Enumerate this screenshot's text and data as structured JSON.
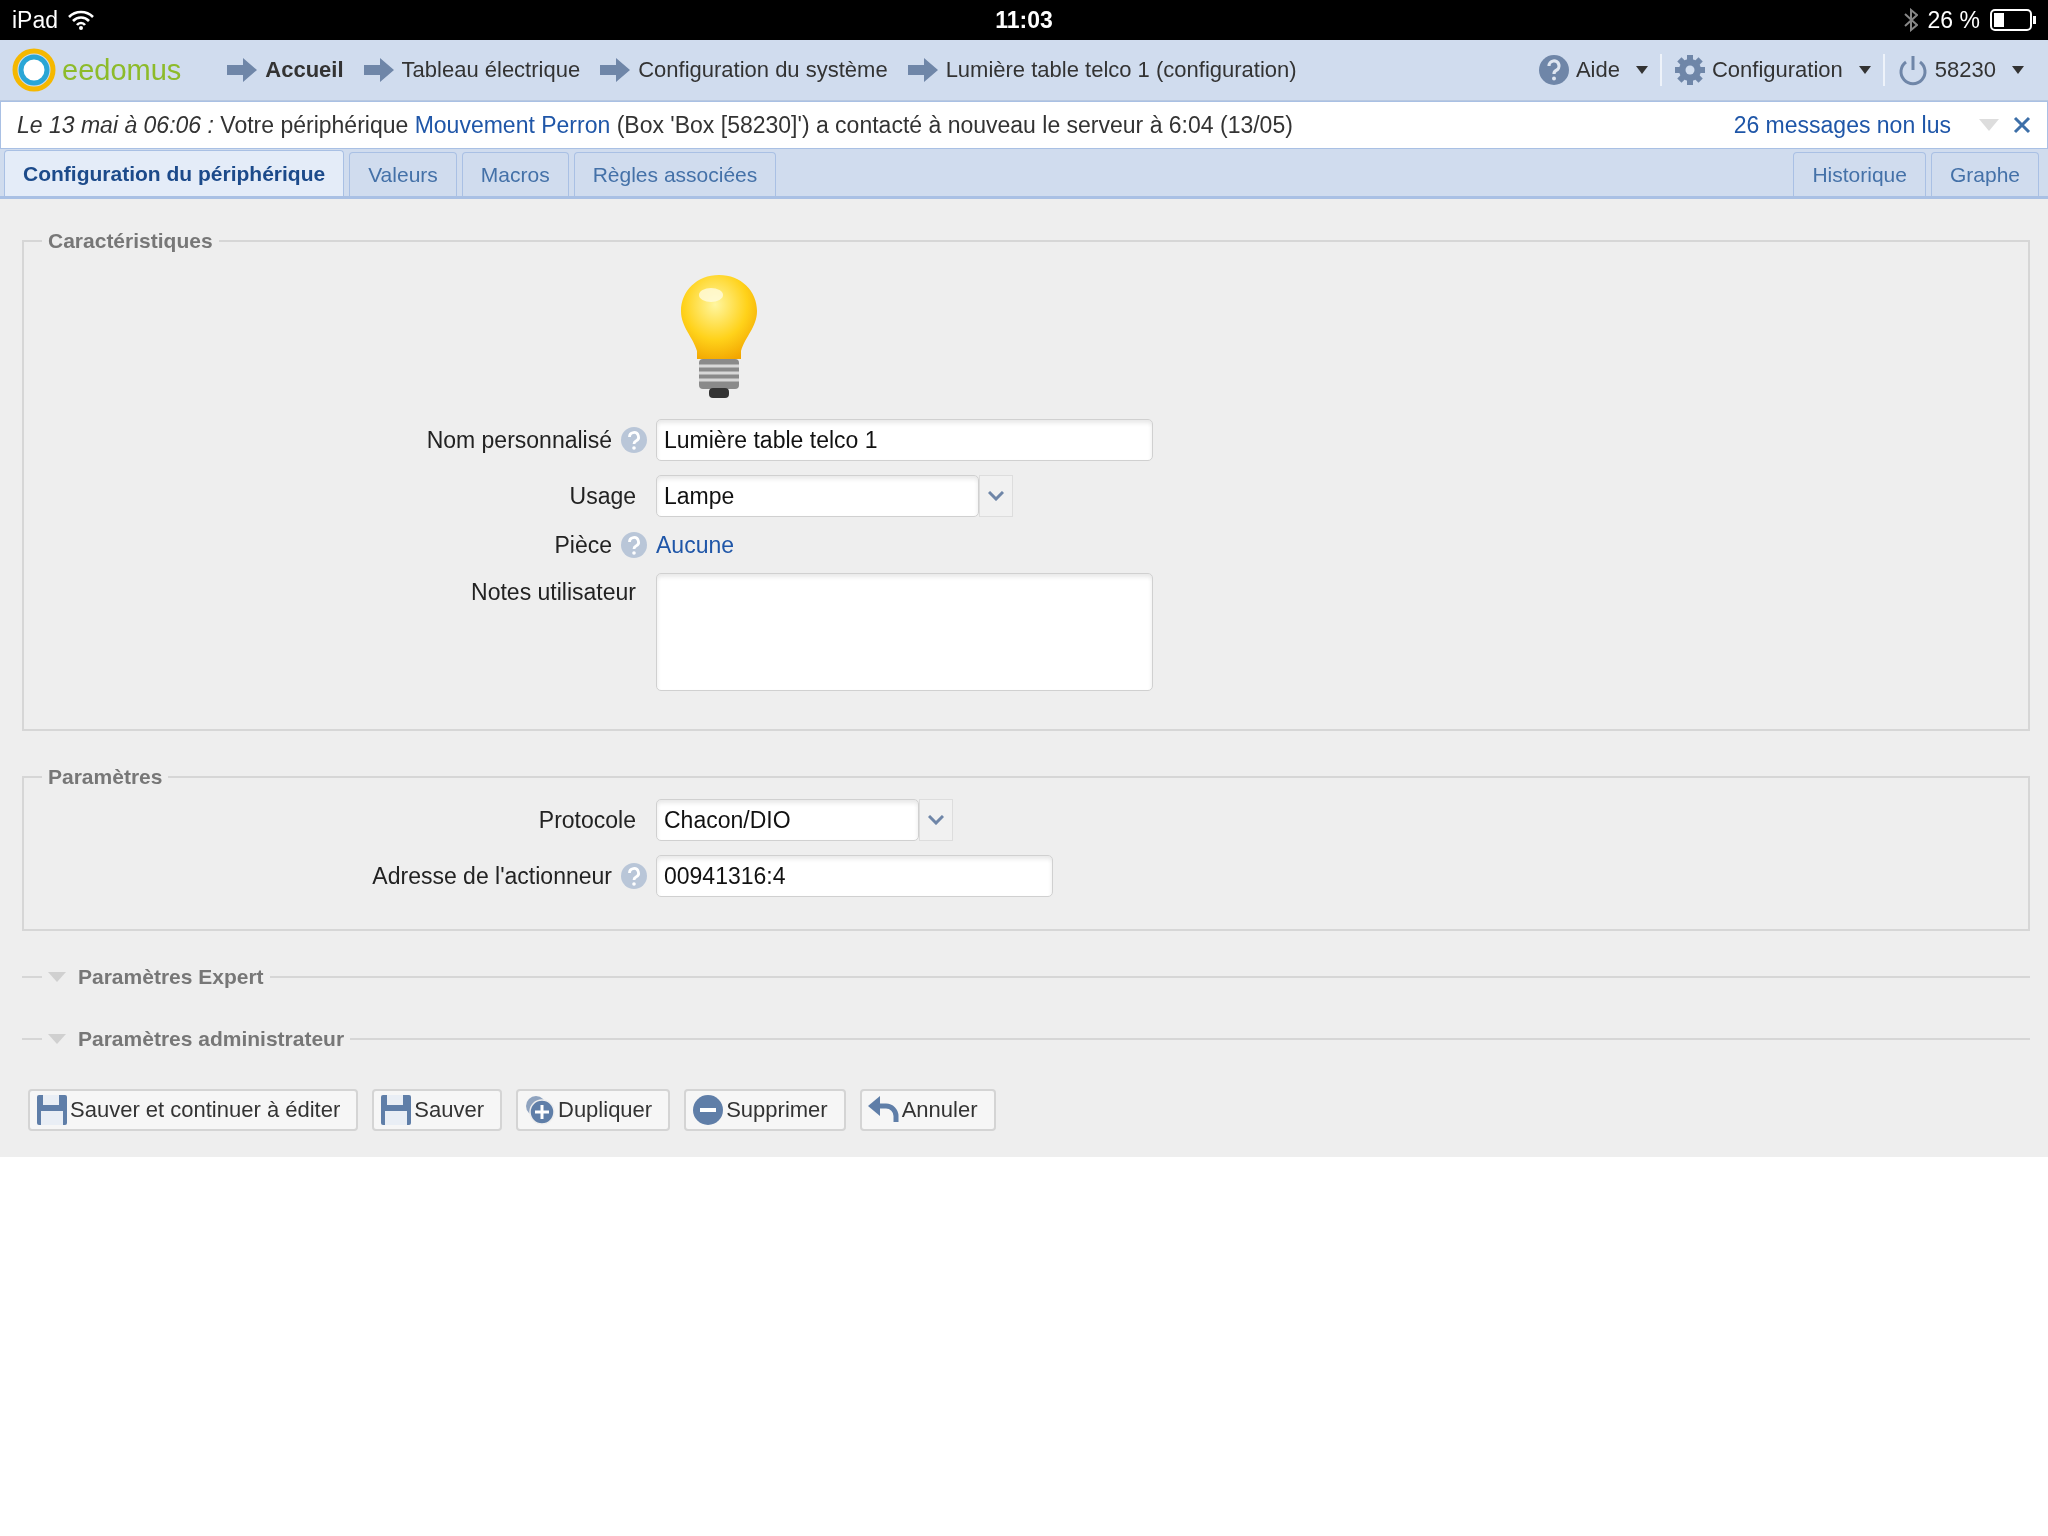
{
  "status_bar": {
    "device": "iPad",
    "time": "11:03",
    "battery": "26 %"
  },
  "nav": {
    "logo": "eedomus",
    "breadcrumbs": [
      {
        "label": "Accueil",
        "bold": true
      },
      {
        "label": "Tableau électrique",
        "bold": false
      },
      {
        "label": "Configuration du système",
        "bold": false
      },
      {
        "label": "Lumière table telco 1 (configuration)",
        "bold": false
      }
    ],
    "menus": [
      {
        "kind": "help",
        "label": "Aide"
      },
      {
        "kind": "gear",
        "label": "Configuration"
      },
      {
        "kind": "power",
        "label": "58230"
      }
    ]
  },
  "notification": {
    "message_start": "*Le 13 mai à 06:06 :* Votre périphérique",
    "link": "Mouvement Perron",
    "message_end": "(Box 'Box [58230]') a contacté à nouveau le serveur à 6:04 (13/05)",
    "unread": "26 messages non lus"
  },
  "tabs": [
    {
      "label": "Configuration du périphérique",
      "selected": true
    },
    {
      "label": "Valeurs",
      "selected": false
    },
    {
      "label": "Macros",
      "selected": false
    },
    {
      "label": "Règles associées",
      "selected": false
    }
  ],
  "right_tabs": [
    {
      "label": "Historique",
      "selected": false
    },
    {
      "label": "Graphe",
      "selected": false
    }
  ],
  "sections": [
    {
      "legend": "Caractéristiques",
      "kind": "device",
      "fields": [
        {
          "kind": "text",
          "label": "Nom personnalisé",
          "help": true,
          "value": "Lumière table telco 1"
        },
        {
          "kind": "select",
          "label": "Usage",
          "help": false,
          "value": "Lampe"
        },
        {
          "kind": "link",
          "label": "Pièce",
          "help": true,
          "value": "Aucune"
        },
        {
          "kind": "textarea",
          "label": "Notes utilisateur",
          "help": false
        }
      ]
    },
    {
      "legend": "Paramètres",
      "kind": "parameters",
      "fields": [
        {
          "kind": "select",
          "label": "Protocole",
          "help": false,
          "value": "Chacon/DIO"
        },
        {
          "kind": "address",
          "label": "Adresse de l'actionneur",
          "help": true,
          "value": "00941316:4"
        }
      ]
    }
  ],
  "collapsed_sections": [
    {
      "legend": "Paramètres Expert",
      "expanded": false
    },
    {
      "legend": "Paramètres administrateur",
      "expanded": false
    }
  ],
  "buttons": [
    {
      "kind": "save",
      "label": "Sauver et continuer à éditer"
    },
    {
      "kind": "save",
      "label": "Sauver"
    },
    {
      "kind": "duplicate",
      "label": "Dupliquer"
    },
    {
      "kind": "delete",
      "label": "Supprimer"
    },
    {
      "kind": "undo",
      "label": "Annuler"
    }
  ]
}
